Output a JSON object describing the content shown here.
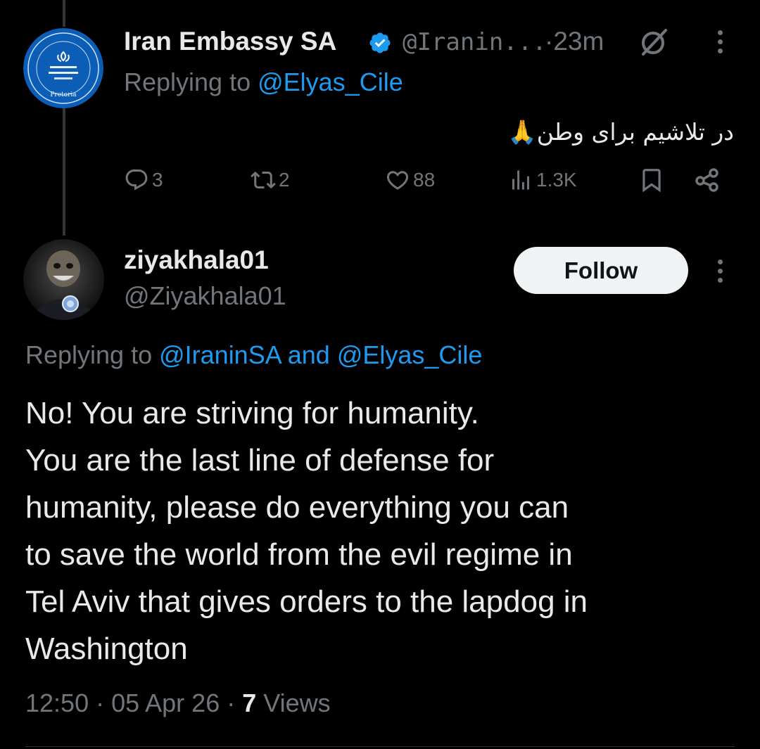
{
  "reply_tweet": {
    "display_name": "Iran Embassy SA",
    "verified": true,
    "handle": "@Iranin...",
    "time": "·23m",
    "replying_to_label": "Replying to ",
    "replying_to_handle": "@Elyas_Cile",
    "text": "در تلاشیم برای وطن🙏",
    "replies": "3",
    "reposts": "2",
    "likes": "88",
    "views": "1.3K",
    "logo_text": "Pretoria"
  },
  "main_tweet": {
    "display_name": "ziyakhala01",
    "handle": "@Ziyakhala01",
    "follow_label": "Follow",
    "replying_to_label": "Replying to ",
    "replying_to_handle_1": "@IraninSA",
    "replying_to_and": " and ",
    "replying_to_handle_2": "@Elyas_Cile",
    "text": "No! You are striving for humanity.\nYou are the last line of defense for\nhumanity, please do everything you can\nto save the world from the evil regime in\nTel Aviv that gives orders to the lapdog in\nWashington",
    "time": "12:50",
    "date": "05 Apr 26",
    "views_count": "7",
    "views_label": " Views"
  },
  "colors": {
    "background": "#000000",
    "text": "#e7e9ea",
    "muted": "#71767b",
    "link": "#1d9bf0",
    "verified": "#1d9bf0",
    "follow_bg": "#eff3f4"
  },
  "icons": [
    "verified-badge-icon",
    "grok-icon",
    "more-icon",
    "reply-icon",
    "repost-icon",
    "like-icon",
    "views-icon",
    "bookmark-icon",
    "share-icon"
  ]
}
